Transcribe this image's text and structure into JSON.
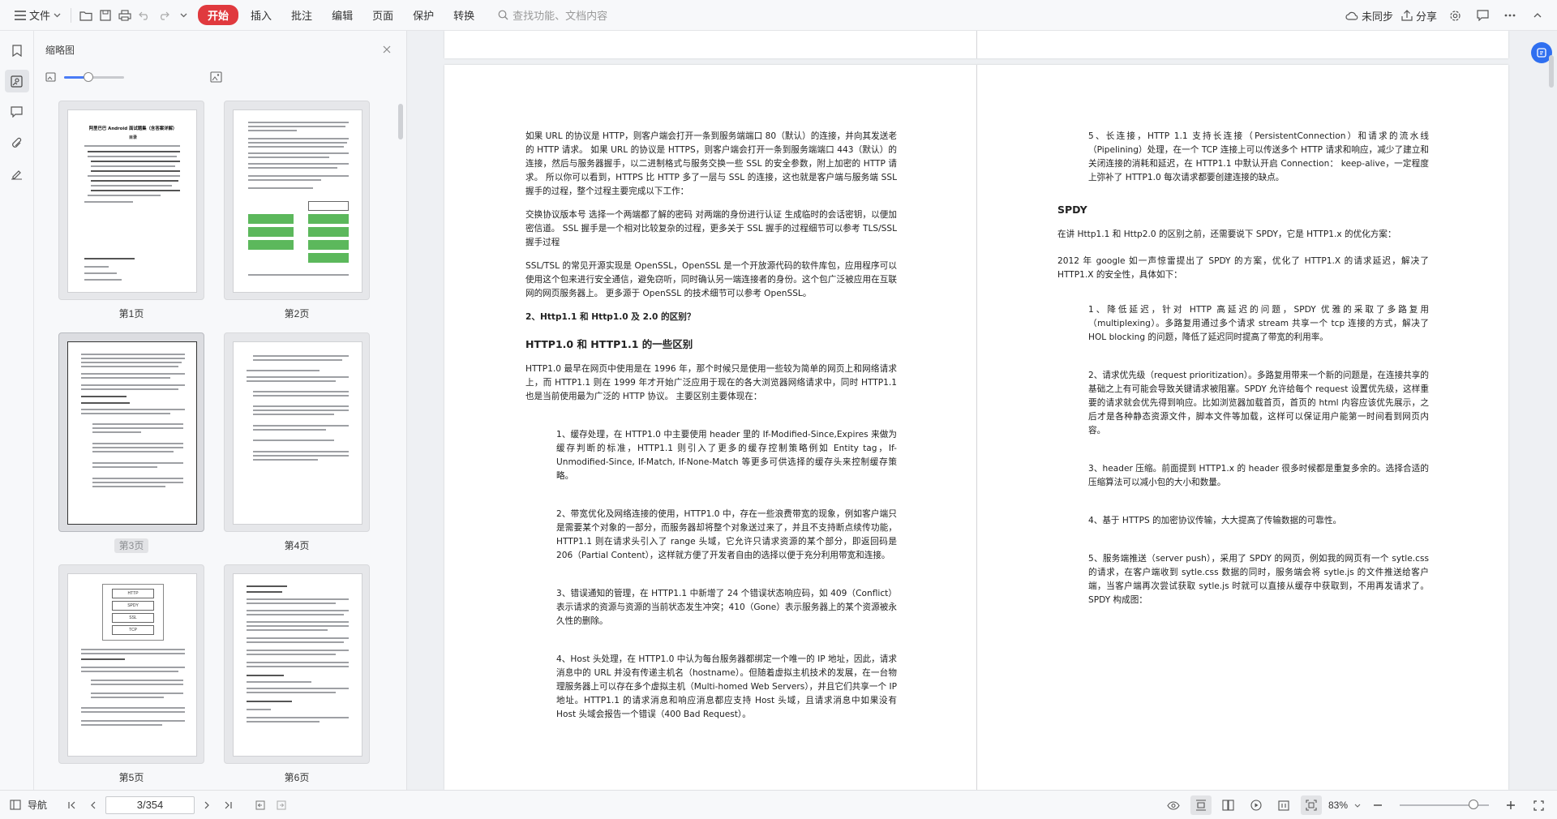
{
  "toolbar": {
    "file_label": "文件",
    "menus": [
      {
        "label": "开始",
        "active": true
      },
      {
        "label": "插入",
        "active": false
      },
      {
        "label": "批注",
        "active": false
      },
      {
        "label": "编辑",
        "active": false
      },
      {
        "label": "页面",
        "active": false
      },
      {
        "label": "保护",
        "active": false
      },
      {
        "label": "转换",
        "active": false
      }
    ],
    "search_placeholder": "查找功能、文档内容",
    "sync_label": "未同步",
    "share_label": "分享"
  },
  "thumbnail_panel": {
    "title": "缩略图",
    "zoom_level": 0.4,
    "pages": [
      {
        "label": "第1页",
        "selected": false
      },
      {
        "label": "第2页",
        "selected": false
      },
      {
        "label": "第3页",
        "selected": true
      },
      {
        "label": "第4页",
        "selected": false
      },
      {
        "label": "第5页",
        "selected": false
      },
      {
        "label": "第6页",
        "selected": false
      }
    ],
    "thumb_texts": {
      "p1_title": "阿里巴巴 Android 面试题集（含答案详解）",
      "p1_toc": "目录",
      "p5_boxes": [
        "HTTP",
        "SPDY",
        "SSL",
        "TCP"
      ]
    }
  },
  "document": {
    "left_page": {
      "p1": "如果 URL 的协议是 HTTP，则客户端会打开一条到服务端端口 80（默认）的连接，并向其发送老的 HTTP 请求。 如果 URL 的协议是 HTTPS，则客户端会打开一条到服务端端口 443（默认）的连接，然后与服务器握手，以二进制格式与服务交换一些 SSL 的安全参数，附上加密的 HTTP 请求。 所以你可以看到，HTTPS 比 HTTP 多了一层与 SSL 的连接，这也就是客户端与服务端 SSL 握手的过程，整个过程主要完成以下工作：",
      "p2": "交换协议版本号 选择一个两端都了解的密码 对两端的身份进行认证 生成临时的会话密钥，以便加密信道。 SSL 握手是一个相对比较复杂的过程，更多关于 SSL 握手的过程细节可以参考 TLS/SSL 握手过程",
      "p3": "SSL/TSL 的常见开源实现是 OpenSSL，OpenSSL 是一个开放源代码的软件库包，应用程序可以使用这个包来进行安全通信，避免窃听，同时确认另一端连接者的身份。这个包广泛被应用在互联网的网页服务器上。 更多源于 OpenSSL 的技术细节可以参考 OpenSSL。",
      "h3": "2、Http1.1 和 Http1.0 及 2.0 的区别？",
      "h2": "HTTP1.0 和 HTTP1.1 的一些区别",
      "p4": "HTTP1.0 最早在网页中使用是在 1996 年，那个时候只是使用一些较为简单的网页上和网络请求上，而 HTTP1.1 则在 1999 年才开始广泛应用于现在的各大浏览器网络请求中，同时 HTTP1.1 也是当前使用最为广泛的 HTTP 协议。 主要区别主要体现在：",
      "i1": "1、缓存处理，在 HTTP1.0 中主要使用 header 里的 If-Modified-Since,Expires 来做为缓存判断的标准，HTTP1.1 则引入了更多的缓存控制策略例如 Entity tag，If-Unmodified-Since, If-Match, If-None-Match 等更多可供选择的缓存头来控制缓存策略。",
      "i2": "2、带宽优化及网络连接的使用，HTTP1.0 中，存在一些浪费带宽的现象，例如客户端只是需要某个对象的一部分，而服务器却将整个对象送过来了，并且不支持断点续传功能，HTTP1.1 则在请求头引入了 range 头域，它允许只请求资源的某个部分，即返回码是 206（Partial Content），这样就方便了开发者自由的选择以便于充分利用带宽和连接。",
      "i3": "3、错误通知的管理，在 HTTP1.1 中新增了 24 个错误状态响应码，如 409（Conflict）表示请求的资源与资源的当前状态发生冲突；410（Gone）表示服务器上的某个资源被永久性的删除。",
      "i4": "4、Host 头处理，在 HTTP1.0 中认为每台服务器都绑定一个唯一的 IP 地址，因此，请求消息中的 URL 并没有传递主机名（hostname）。但随着虚拟主机技术的发展，在一台物理服务器上可以存在多个虚拟主机（Multi-homed Web Servers），并且它们共享一个 IP 地址。HTTP1.1 的请求消息和响应消息都应支持 Host 头域，且请求消息中如果没有 Host 头域会报告一个错误（400 Bad Request）。"
    },
    "right_page": {
      "i5": "5、长连接，HTTP 1.1 支持长连接（PersistentConnection）和请求的流水线（Pipelining）处理，在一个 TCP 连接上可以传送多个 HTTP 请求和响应，减少了建立和关闭连接的消耗和延迟，在 HTTP1.1 中默认开启 Connection： keep-alive，一定程度上弥补了 HTTP1.0 每次请求都要创建连接的缺点。",
      "h2": "SPDY",
      "p1": "在讲 Http1.1 和 Http2.0 的区别之前，还需要说下 SPDY，它是 HTTP1.x 的优化方案：",
      "p2": "2012 年 google 如一声惊雷提出了 SPDY 的方案，优化了 HTTP1.X 的请求延迟，解决了 HTTP1.X 的安全性，具体如下：",
      "s1": "1、降低延迟，针对 HTTP 高延迟的问题，SPDY 优雅的采取了多路复用（multiplexing）。多路复用通过多个请求 stream 共享一个 tcp 连接的方式，解决了 HOL blocking 的问题，降低了延迟同时提高了带宽的利用率。",
      "s2": "2、请求优先级（request prioritization）。多路复用带来一个新的问题是，在连接共享的基础之上有可能会导致关键请求被阻塞。SPDY 允许给每个 request 设置优先级，这样重要的请求就会优先得到响应。比如浏览器加载首页，首页的 html 内容应该优先展示，之后才是各种静态资源文件，脚本文件等加载，这样可以保证用户能第一时间看到网页内容。",
      "s3": "3、header 压缩。前面提到 HTTP1.x 的 header 很多时候都是重复多余的。选择合适的压缩算法可以减小包的大小和数量。",
      "s4": "4、基于 HTTPS 的加密协议传输，大大提高了传输数据的可靠性。",
      "s5": "5、服务端推送（server push），采用了 SPDY 的网页，例如我的网页有一个 sytle.css 的请求，在客户端收到 sytle.css 数据的同时，服务端会将 sytle.js 的文件推送给客户端，当客户端再次尝试获取 sytle.js 时就可以直接从缓存中获取到，不用再发请求了。SPDY 构成图："
    }
  },
  "statusbar": {
    "nav_label": "导航",
    "page_indicator": "3/354",
    "zoom_label": "83%",
    "zoom_level": 0.83
  },
  "colors": {
    "accent_red": "#e0393e",
    "accent_blue": "#2f6ff0",
    "toolbar_bg": "#f7f8fa"
  }
}
